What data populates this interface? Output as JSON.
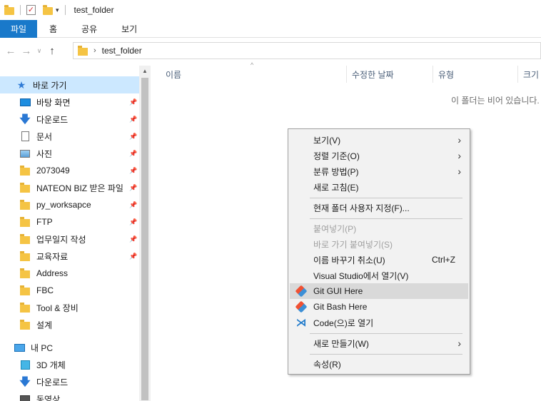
{
  "window": {
    "title": "test_folder"
  },
  "ribbon": {
    "tabs": [
      "파일",
      "홈",
      "공유",
      "보기"
    ]
  },
  "address": {
    "path_segment": "test_folder",
    "separator": "›"
  },
  "sidebar": {
    "quick_access": "바로 가기",
    "items": [
      {
        "label": "바탕 화면",
        "icon": "desktop-icon",
        "pinned": true
      },
      {
        "label": "다운로드",
        "icon": "download-arrow-icon",
        "pinned": true
      },
      {
        "label": "문서",
        "icon": "document-icon",
        "pinned": true
      },
      {
        "label": "사진",
        "icon": "picture-icon",
        "pinned": true
      },
      {
        "label": "2073049",
        "icon": "folder-icon",
        "pinned": true
      },
      {
        "label": "NATEON BIZ 받은 파일",
        "icon": "folder-icon",
        "pinned": true
      },
      {
        "label": "py_worksapce",
        "icon": "folder-icon",
        "pinned": true
      },
      {
        "label": "FTP",
        "icon": "folder-icon",
        "pinned": true
      },
      {
        "label": "업무일지 작성",
        "icon": "folder-icon",
        "pinned": true
      },
      {
        "label": "교육자료",
        "icon": "folder-icon",
        "pinned": true
      },
      {
        "label": "Address",
        "icon": "folder-icon",
        "pinned": false
      },
      {
        "label": "FBC",
        "icon": "folder-icon",
        "pinned": false
      },
      {
        "label": "Tool & 장비",
        "icon": "folder-icon",
        "pinned": false
      },
      {
        "label": "설계",
        "icon": "folder-icon",
        "pinned": false
      }
    ],
    "this_pc": "내 PC",
    "pc_items": [
      {
        "label": "3D 개체",
        "icon": "3d-objects-icon"
      },
      {
        "label": "다운로드",
        "icon": "download-arrow-icon"
      },
      {
        "label": "동영상",
        "icon": "video-icon"
      }
    ]
  },
  "columns": {
    "name": "이름",
    "modified": "수정한 날짜",
    "type": "유형",
    "size": "크기"
  },
  "content": {
    "empty_message": "이 폴더는 비어 있습니다."
  },
  "context_menu": {
    "view": "보기(V)",
    "sort": "정렬 기준(O)",
    "group": "분류 방법(P)",
    "refresh": "새로 고침(E)",
    "customize": "현재 폴더 사용자 지정(F)...",
    "paste": "붙여넣기(P)",
    "paste_shortcut": "바로 가기 붙여넣기(S)",
    "undo_rename": "이름 바꾸기 취소(U)",
    "undo_shortcut": "Ctrl+Z",
    "open_vs": "Visual Studio에서 열기(V)",
    "git_gui": "Git GUI Here",
    "git_bash": "Git Bash Here",
    "open_code": "Code(으)로 열기",
    "new": "새로 만들기(W)",
    "properties": "속성(R)"
  },
  "colors": {
    "accent": "#1979ca",
    "selection": "#cce8ff",
    "menu_bg": "#f2f2f2",
    "menu_hover": "#d9d9d9"
  }
}
